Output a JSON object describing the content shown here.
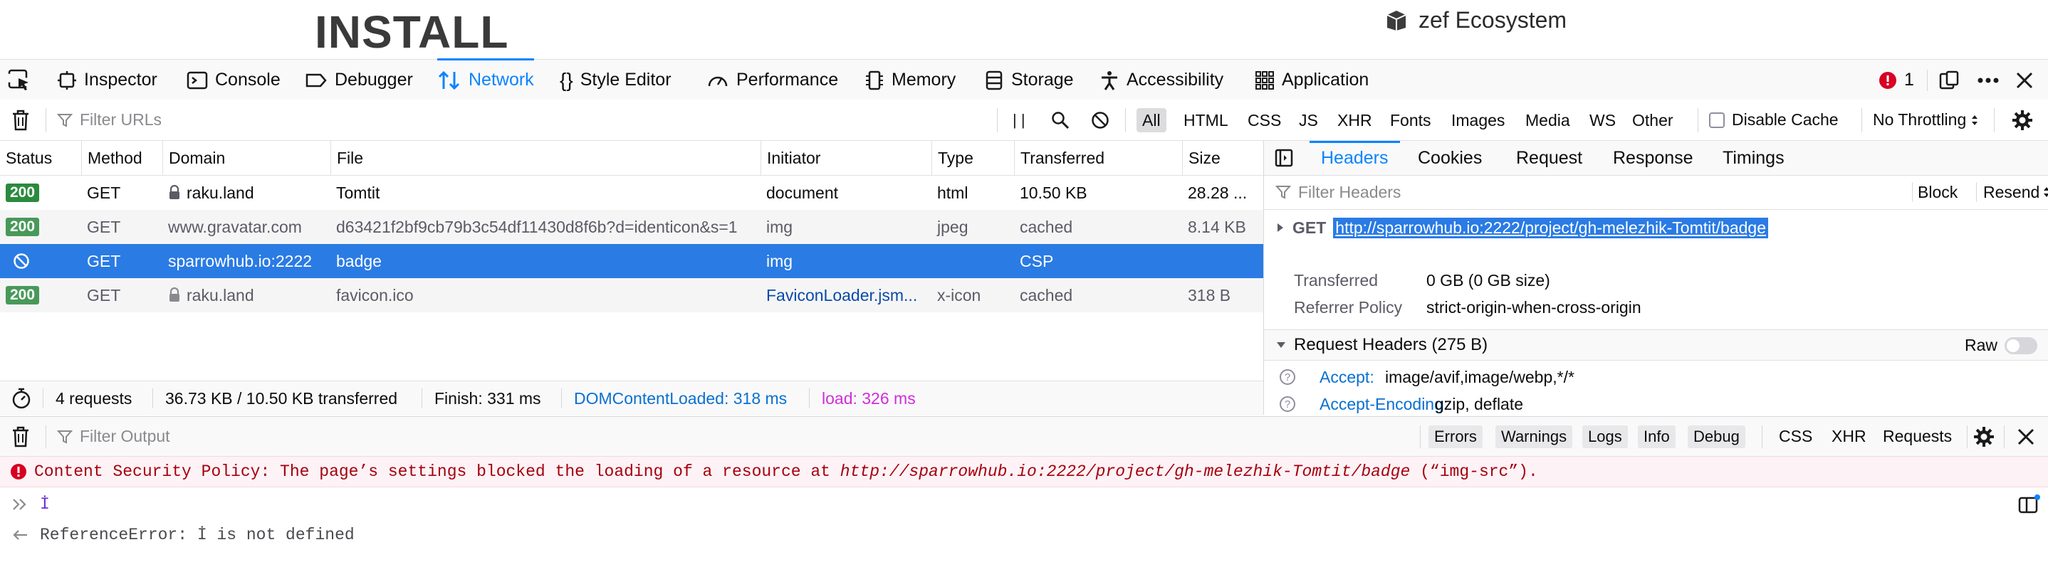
{
  "page": {
    "install_heading": "INSTALL",
    "ecosystem_label": "zef Ecosystem"
  },
  "toolbox": {
    "tabs": [
      {
        "label": "Inspector"
      },
      {
        "label": "Console"
      },
      {
        "label": "Debugger"
      },
      {
        "label": "Network"
      },
      {
        "label": "Style Editor"
      },
      {
        "label": "Performance"
      },
      {
        "label": "Memory"
      },
      {
        "label": "Storage"
      },
      {
        "label": "Accessibility"
      },
      {
        "label": "Application"
      }
    ],
    "selected_tab": "Network",
    "error_count": "1"
  },
  "network_toolbar": {
    "filter_placeholder": "Filter URLs",
    "types": [
      "All",
      "HTML",
      "CSS",
      "JS",
      "XHR",
      "Fonts",
      "Images",
      "Media",
      "WS",
      "Other"
    ],
    "selected_type": "All",
    "disable_cache_label": "Disable Cache",
    "throttling_label": "No Throttling",
    "pause_glyph": "| |"
  },
  "requests": {
    "columns": [
      "Status",
      "Method",
      "Domain",
      "File",
      "Initiator",
      "Type",
      "Transferred",
      "Size"
    ],
    "rows": [
      {
        "status": "200",
        "method": "GET",
        "domain": "raku.land",
        "file": "Tomtit",
        "initiator": "document",
        "type": "html",
        "transferred": "10.50 KB",
        "size": "28.28 ..."
      },
      {
        "status": "200",
        "method": "GET",
        "domain": "www.gravatar.com",
        "file": "d63421f2bf9cb79b3c54df11430d8f6b?d=identicon&s=1",
        "initiator": "img",
        "type": "jpeg",
        "transferred": "cached",
        "size": "8.14 KB"
      },
      {
        "status": "",
        "method": "GET",
        "domain": "sparrowhub.io:2222",
        "file": "badge",
        "initiator": "img",
        "type": "",
        "transferred": "CSP",
        "size": ""
      },
      {
        "status": "200",
        "method": "GET",
        "domain": "raku.land",
        "file": "favicon.ico",
        "initiator": "FaviconLoader.jsm...",
        "type": "x-icon",
        "transferred": "cached",
        "size": "318 B"
      }
    ],
    "selected_row": 2
  },
  "status_bar": {
    "requests": "4 requests",
    "transferred": "36.73 KB / 10.50 KB transferred",
    "finish": "Finish: 331 ms",
    "dcl": "DOMContentLoaded: 318 ms",
    "load": "load: 326 ms"
  },
  "side_panel": {
    "tabs": [
      "Headers",
      "Cookies",
      "Request",
      "Response",
      "Timings"
    ],
    "selected_tab": "Headers",
    "filter_placeholder": "Filter Headers",
    "block_label": "Block",
    "resend_label": "Resend",
    "method": "GET",
    "url": "http://sparrowhub.io:2222/project/gh-melezhik-Tomtit/badge",
    "transferred_key": "Transferred",
    "transferred_val": "0 GB (0 GB size)",
    "referrer_key": "Referrer Policy",
    "referrer_val": "strict-origin-when-cross-origin",
    "request_headers_title": "Request Headers (275 B)",
    "raw_label": "Raw",
    "headers": [
      {
        "name": "Accept:",
        "value": "image/avif,image/webp,*/*"
      },
      {
        "name": "Accept-Encoding:",
        "value": "gzip, deflate"
      }
    ]
  },
  "console": {
    "filter_placeholder": "Filter Output",
    "filters": [
      "Errors",
      "Warnings",
      "Logs",
      "Info",
      "Debug"
    ],
    "request_filters": [
      "CSS",
      "XHR",
      "Requests"
    ],
    "error_prefix": "Content Security Policy: The page’s settings blocked the loading of a resource at ",
    "error_url": "http://sparrowhub.io:2222/project/gh-melezhik-Tomtit/badge",
    "error_suffix": " (“img-src”).",
    "input_text": "İ",
    "result_text": "ReferenceError: İ is not defined"
  },
  "colors": {
    "accent": "#0a84ff",
    "selected_row": "#2a7be4",
    "status_ok": "#2b8a3e",
    "error": "#d70022",
    "dcl": "#0a70d0",
    "load": "#d12ed8"
  }
}
